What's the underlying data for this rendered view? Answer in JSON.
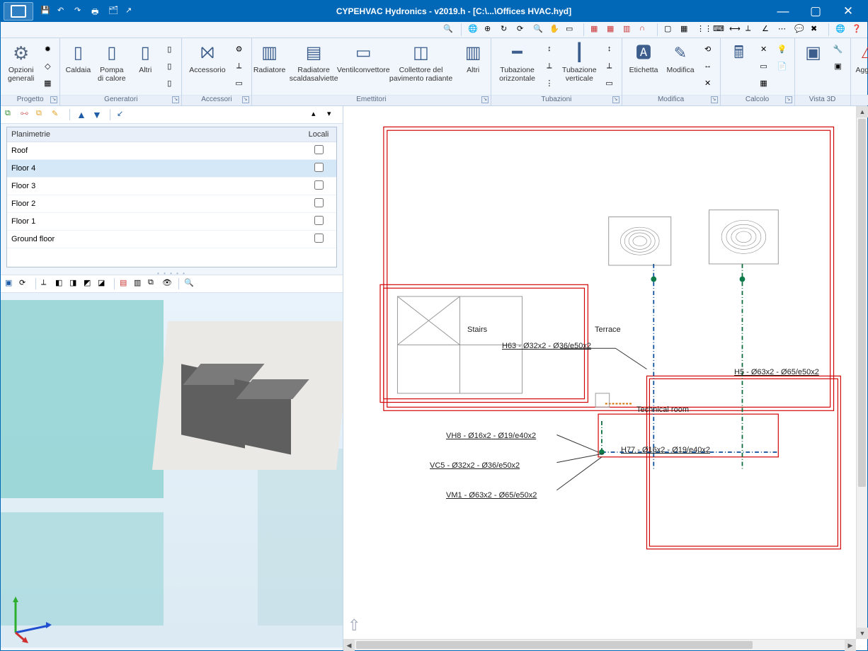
{
  "titlebar": {
    "title": "CYPEHVAC Hydronics - v2019.h - [C:\\...\\Offices HVAC.hyd]"
  },
  "ribbon": {
    "groups": {
      "progetto": {
        "label": "Progetto",
        "opzioni": "Opzioni generali"
      },
      "generatori": {
        "label": "Generatori",
        "caldaia": "Caldaia",
        "pompa": "Pompa di calore",
        "altri": "Altri"
      },
      "accessori": {
        "label": "Accessori",
        "accessorio": "Accessorio"
      },
      "emettitori": {
        "label": "Emettitori",
        "radiatore": "Radiatore",
        "scalda": "Radiatore scaldasalviette",
        "ventil": "Ventilconvettore",
        "collettore": "Collettore del pavimento radiante",
        "altri": "Altri"
      },
      "tubazioni": {
        "label": "Tubazioni",
        "orizz": "Tubazione orizzontale",
        "vert": "Tubazione verticale"
      },
      "modifica": {
        "label": "Modifica",
        "etichetta": "Etichetta",
        "modifica": "Modifica"
      },
      "calcolo": {
        "label": "Calcolo"
      },
      "vista3d": {
        "label": "Vista 3D"
      },
      "aggiorna": {
        "label": "Aggiorna",
        "btn": "Aggiorn"
      }
    }
  },
  "floorlist": {
    "headers": {
      "plan": "Planimetrie",
      "locali": "Locali"
    },
    "rows": [
      {
        "name": "Roof",
        "checked": false,
        "selected": false
      },
      {
        "name": "Floor 4",
        "checked": false,
        "selected": true
      },
      {
        "name": "Floor 3",
        "checked": false,
        "selected": false
      },
      {
        "name": "Floor 2",
        "checked": false,
        "selected": false
      },
      {
        "name": "Floor 1",
        "checked": false,
        "selected": false
      },
      {
        "name": "Ground floor",
        "checked": false,
        "selected": false
      }
    ]
  },
  "plan": {
    "rooms": {
      "stairs": "Stairs",
      "terrace": "Terrace",
      "techroom": "Technical room"
    },
    "labels": {
      "h63": "H63 - Ø32x2 - Ø36/e50x2",
      "h5": "H5 - Ø63x2 - Ø65/e50x2",
      "vh8": "VH8 - Ø16x2 - Ø19/e40x2",
      "h77": "H77 - Ø16x2 - Ø19/e40x2",
      "vc5": "VC5 - Ø32x2 - Ø36/e50x2",
      "vm1": "VM1 - Ø63x2 - Ø65/e50x2"
    }
  }
}
